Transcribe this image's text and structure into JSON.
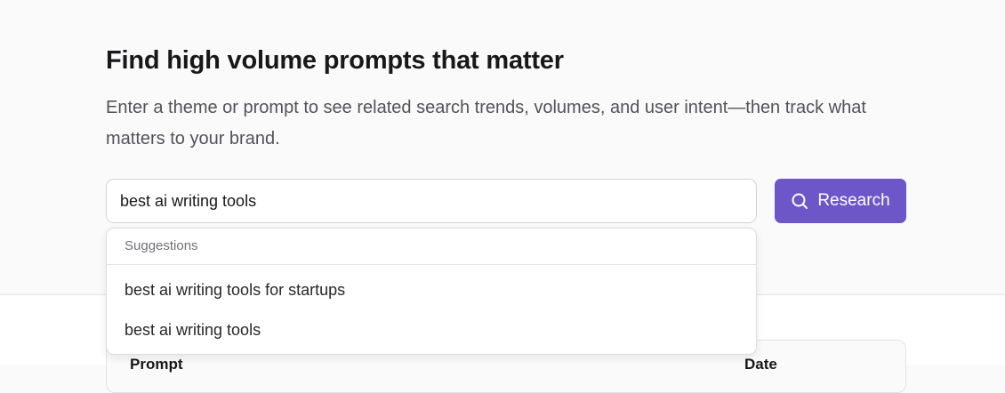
{
  "header": {
    "title": "Find high volume prompts that matter",
    "subtitle": "Enter a theme or prompt to see related search trends, volumes, and user intent—then track what matters to your brand."
  },
  "search": {
    "value": "best ai writing tools",
    "button_label": "Research",
    "button_icon": "search-icon"
  },
  "suggestions": {
    "header": "Suggestions",
    "items": [
      "best ai writing tools for startups",
      "best ai writing tools"
    ]
  },
  "table": {
    "columns": [
      "Prompt",
      "Date"
    ]
  },
  "colors": {
    "accent": "#6c56c8",
    "background": "#fafafa"
  }
}
